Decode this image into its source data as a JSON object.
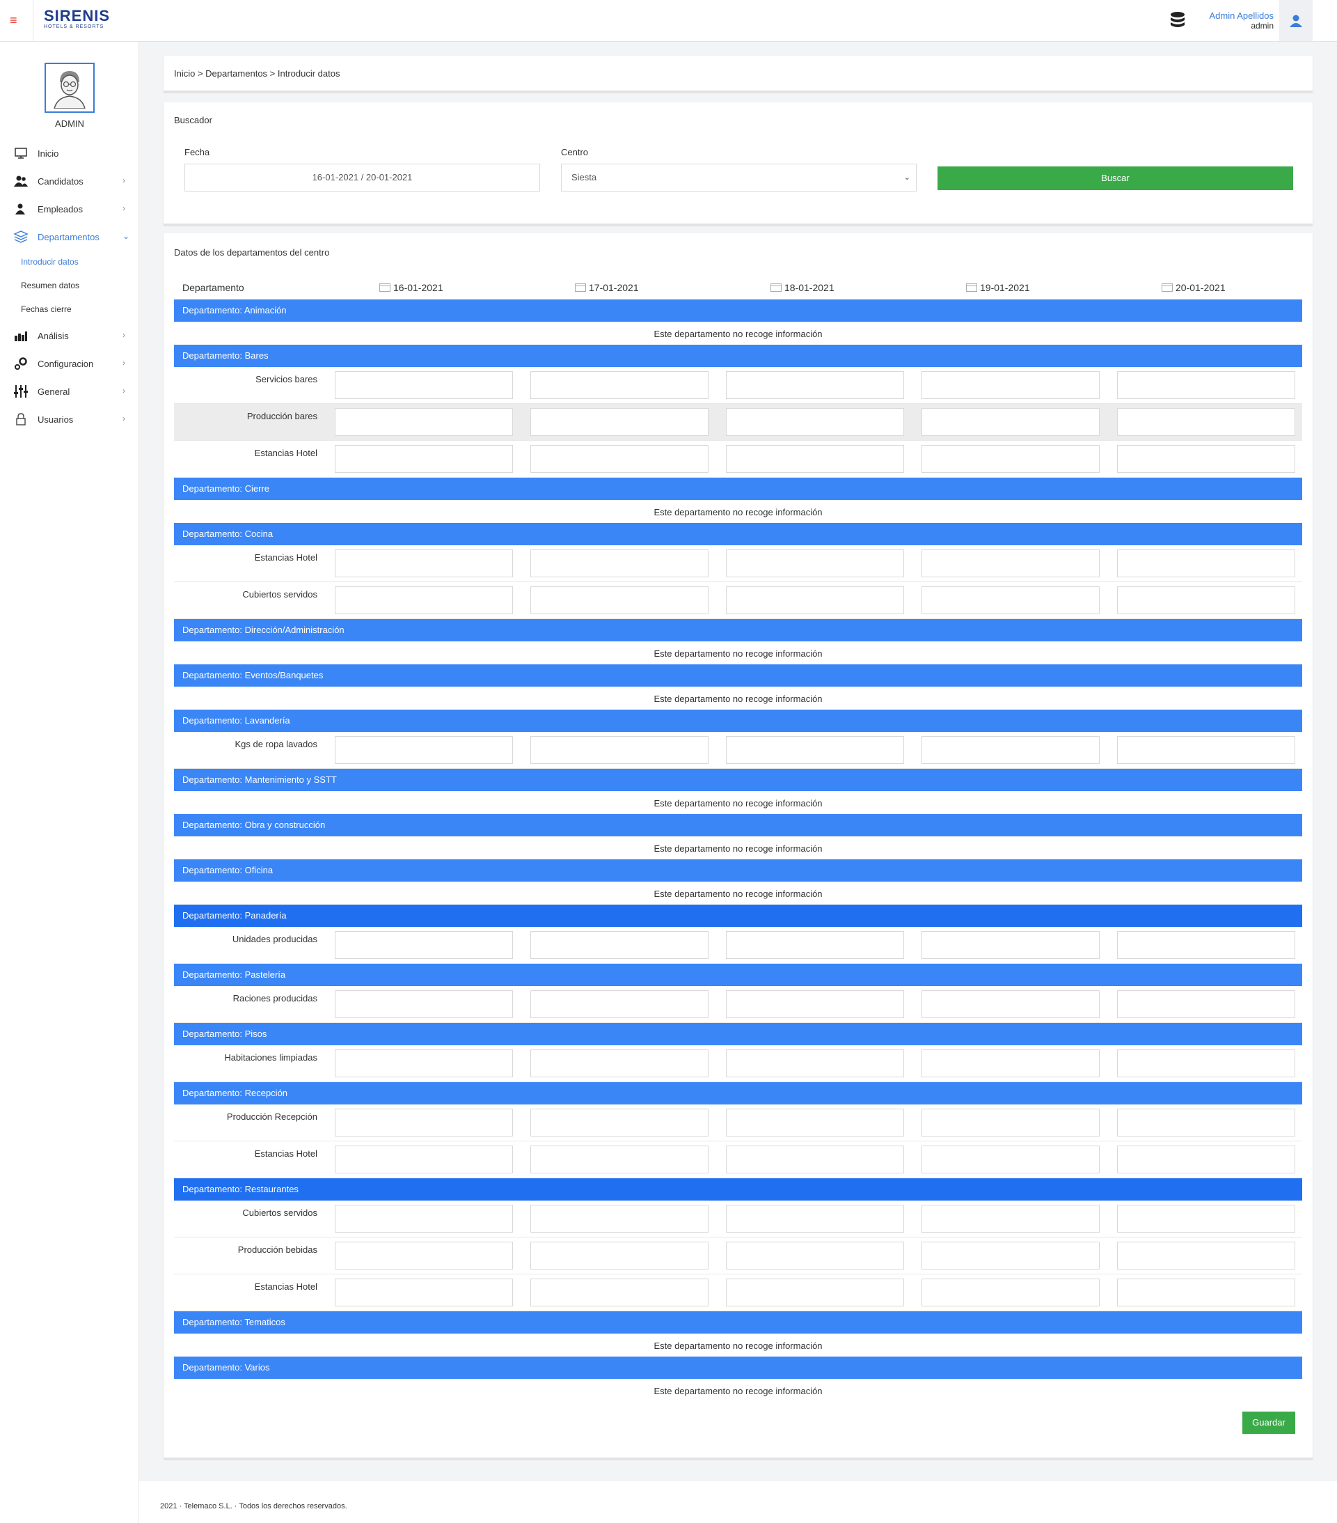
{
  "topbar": {
    "logo_main": "SIRENIS",
    "logo_sub": "HOTELS & RESORTS",
    "user_name": "Admin Apellidos",
    "user_role": "admin"
  },
  "sidebar": {
    "admin_label": "ADMIN",
    "items": [
      {
        "label": "Inicio",
        "icon": "monitor-icon"
      },
      {
        "label": "Candidatos",
        "icon": "users-icon"
      },
      {
        "label": "Empleados",
        "icon": "user-icon"
      },
      {
        "label": "Departamentos",
        "icon": "layers-icon"
      },
      {
        "label": "Análisis",
        "icon": "bar-chart-icon"
      },
      {
        "label": "Configuracion",
        "icon": "settings-icon"
      },
      {
        "label": "General",
        "icon": "sliders-icon"
      },
      {
        "label": "Usuarios",
        "icon": "lock-icon"
      }
    ],
    "subitems": [
      "Introducir datos",
      "Resumen datos",
      "Fechas cierre"
    ]
  },
  "breadcrumb": "Inicio > Departamentos > Introducir datos",
  "search": {
    "title": "Buscador",
    "fecha_label": "Fecha",
    "fecha_value": "16-01-2021 / 20-01-2021",
    "centro_label": "Centro",
    "centro_value": "Siesta",
    "button": "Buscar"
  },
  "data_panel": {
    "title": "Datos de los departamentos del centro",
    "col_departamento": "Departamento",
    "dates": [
      "16-01-2021",
      "17-01-2021",
      "18-01-2021",
      "19-01-2021",
      "20-01-2021"
    ],
    "no_info": "Este departamento no recoge información",
    "save_button": "Guardar",
    "departments": [
      {
        "name": "Departamento: Animación",
        "metrics": []
      },
      {
        "name": "Departamento: Bares",
        "metrics": [
          "Servicios bares",
          "Producción bares",
          "Estancias Hotel"
        ]
      },
      {
        "name": "Departamento: Cierre",
        "metrics": []
      },
      {
        "name": "Departamento: Cocina",
        "metrics": [
          "Estancias Hotel",
          "Cubiertos servidos"
        ]
      },
      {
        "name": "Departamento: Dirección/Administración",
        "metrics": []
      },
      {
        "name": "Departamento: Eventos/Banquetes",
        "metrics": []
      },
      {
        "name": "Departamento: Lavandería",
        "metrics": [
          "Kgs de ropa lavados"
        ]
      },
      {
        "name": "Departamento: Mantenimiento y SSTT",
        "metrics": []
      },
      {
        "name": "Departamento: Obra y construcción",
        "metrics": []
      },
      {
        "name": "Departamento: Oficina",
        "metrics": []
      },
      {
        "name": "Departamento: Panadería",
        "metrics": [
          "Unidades producidas"
        ]
      },
      {
        "name": "Departamento: Pastelería",
        "metrics": [
          "Raciones producidas"
        ]
      },
      {
        "name": "Departamento: Pisos",
        "metrics": [
          "Habitaciones limpiadas"
        ]
      },
      {
        "name": "Departamento: Recepción",
        "metrics": [
          "Producción Recepción",
          "Estancias Hotel"
        ]
      },
      {
        "name": "Departamento: Restaurantes",
        "metrics": [
          "Cubiertos servidos",
          "Producción bebidas",
          "Estancias Hotel"
        ]
      },
      {
        "name": "Departamento: Tematicos",
        "metrics": []
      },
      {
        "name": "Departamento: Varios",
        "metrics": []
      }
    ]
  },
  "footer": "2021 · Telemaco S.L. · Todos los derechos reservados.",
  "colors": {
    "primary": "#3b86f6",
    "accent_green": "#3aaa48",
    "link_blue": "#3b7dd8"
  }
}
